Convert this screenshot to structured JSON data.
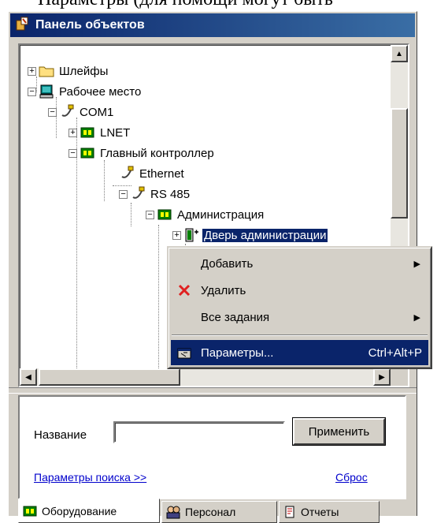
{
  "titlebar": {
    "title": "Панель объектов",
    "icon": "objects-panel-icon"
  },
  "tree": {
    "nodes": [
      {
        "label": "Шлейфы",
        "expander": "+",
        "icon": "folder-icon"
      },
      {
        "label": "Рабочее место",
        "expander": "−",
        "icon": "workstation-icon"
      },
      {
        "label": "COM1",
        "expander": "−",
        "icon": "port-icon"
      },
      {
        "label": "LNET",
        "expander": "+",
        "icon": "controller-icon"
      },
      {
        "label": "Главный контроллер",
        "expander": "−",
        "icon": "controller-icon"
      },
      {
        "label": "Ethernet",
        "expander": "",
        "icon": "port-icon"
      },
      {
        "label": "RS 485",
        "expander": "−",
        "icon": "port-icon"
      },
      {
        "label": "Администрация",
        "expander": "−",
        "icon": "controller-icon"
      },
      {
        "label": "Дверь администрации",
        "expander": "+",
        "icon": "door-icon",
        "selected": true
      }
    ]
  },
  "context_menu": {
    "items": [
      {
        "label": "Добавить",
        "has_submenu": true,
        "icon": ""
      },
      {
        "label": "Удалить",
        "has_submenu": false,
        "icon": "delete-icon"
      },
      {
        "label": "Все задания",
        "has_submenu": true,
        "icon": ""
      },
      {
        "label": "Параметры...",
        "shortcut": "Ctrl+Alt+P",
        "icon": "properties-icon",
        "highlighted": true
      }
    ]
  },
  "search": {
    "name_label": "Название",
    "name_value": "",
    "apply_label": "Применить",
    "search_params_link": "Параметры поиска >>",
    "reset_link": "Сброс"
  },
  "tabs": [
    {
      "label": "Оборудование",
      "icon": "controller-icon",
      "active": true
    },
    {
      "label": "Персонал",
      "icon": "people-icon",
      "active": false
    },
    {
      "label": "Отчеты",
      "icon": "report-icon",
      "active": false
    }
  ],
  "colors": {
    "titlebar": "#0a246a",
    "selection": "#0a246a",
    "face": "#d4d0c8",
    "link": "#0000cc",
    "delete": "#e02020"
  }
}
